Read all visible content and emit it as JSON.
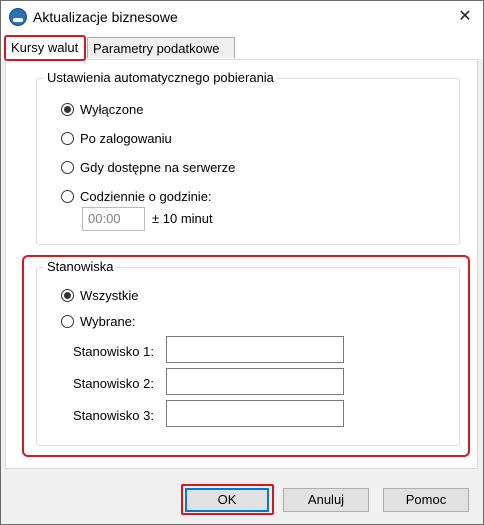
{
  "window": {
    "title": "Aktualizacje biznesowe",
    "close_glyph": "✕"
  },
  "tabs": [
    {
      "label": "Kursy walut",
      "active": true
    },
    {
      "label": "Parametry podatkowe",
      "active": false
    }
  ],
  "auto_download": {
    "legend": "Ustawienia automatycznego pobierania",
    "options": [
      {
        "label": "Wyłączone",
        "checked": true
      },
      {
        "label": "Po zalogowaniu",
        "checked": false
      },
      {
        "label": "Gdy dostępne na serwerze",
        "checked": false
      },
      {
        "label": "Codziennie o godzinie:",
        "checked": false
      }
    ],
    "time_value": "00:00",
    "tolerance_label": "± 10 minut"
  },
  "workstations": {
    "legend": "Stanowiska",
    "options": [
      {
        "label": "Wszystkie",
        "checked": true
      },
      {
        "label": "Wybrane:",
        "checked": false
      }
    ],
    "fields": [
      {
        "label": "Stanowisko 1:",
        "value": ""
      },
      {
        "label": "Stanowisko 2:",
        "value": ""
      },
      {
        "label": "Stanowisko 3:",
        "value": ""
      }
    ]
  },
  "buttons": {
    "ok": "OK",
    "cancel": "Anuluj",
    "help": "Pomoc"
  },
  "colors": {
    "highlight": "#d9161c",
    "accent": "#0078d7"
  }
}
